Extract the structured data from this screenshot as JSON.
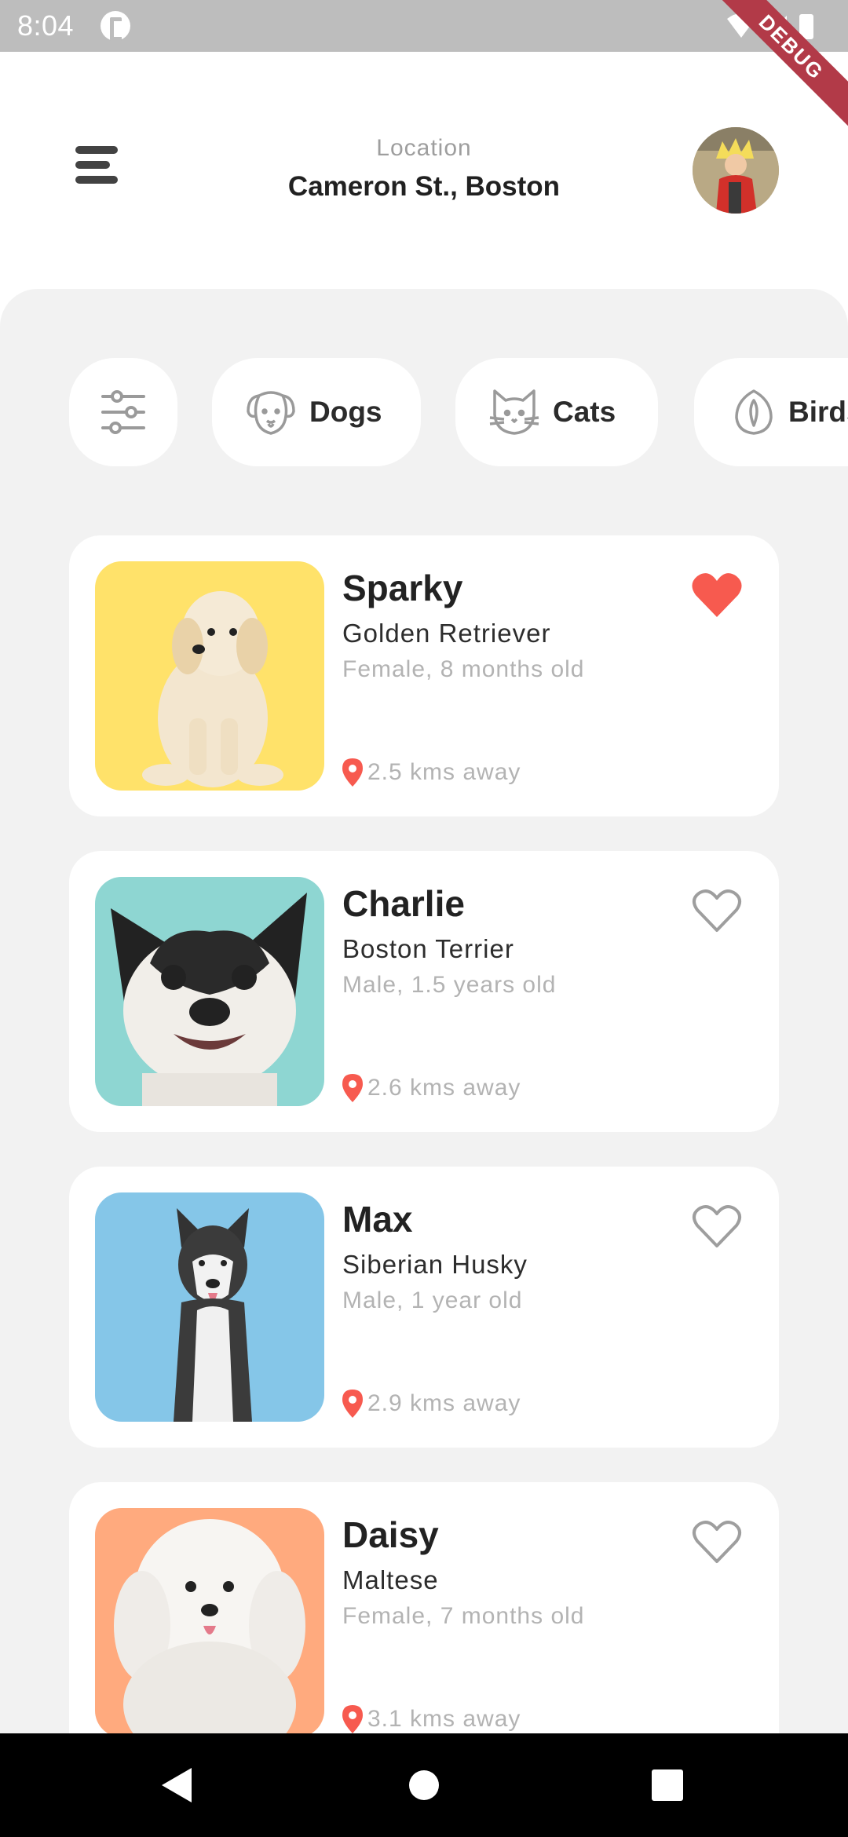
{
  "status_bar": {
    "time": "8:04",
    "debug_label": "DEBUG"
  },
  "header": {
    "location_label": "Location",
    "location_value": "Cameron St., Boston",
    "menu_icon": "menu-icon",
    "avatar_icon": "avatar"
  },
  "categories": [
    {
      "label": "",
      "icon": "filter-sliders-icon"
    },
    {
      "label": "Dogs",
      "icon": "dog-icon"
    },
    {
      "label": "Cats",
      "icon": "cat-icon"
    },
    {
      "label": "Birds",
      "icon": "bird-icon"
    }
  ],
  "pets": [
    {
      "name": "Sparky",
      "breed": "Golden Retriever",
      "info": "Female, 8 months old",
      "distance": "2.5 kms away",
      "favorite": true,
      "bg": "#FFE26A"
    },
    {
      "name": "Charlie",
      "breed": "Boston Terrier",
      "info": "Male, 1.5 years old",
      "distance": "2.6 kms away",
      "favorite": false,
      "bg": "#8ED6D2"
    },
    {
      "name": "Max",
      "breed": "Siberian Husky",
      "info": "Male, 1 year old",
      "distance": "2.9 kms away",
      "favorite": false,
      "bg": "#85C6E8"
    },
    {
      "name": "Daisy",
      "breed": "Maltese",
      "info": "Female, 7 months old",
      "distance": "3.1 kms away",
      "favorite": false,
      "bg": "#FFAA7E"
    }
  ],
  "colors": {
    "accent": "#F75A4F",
    "panel_bg": "#F2F2F2",
    "muted_text": "#B3B3B3"
  }
}
